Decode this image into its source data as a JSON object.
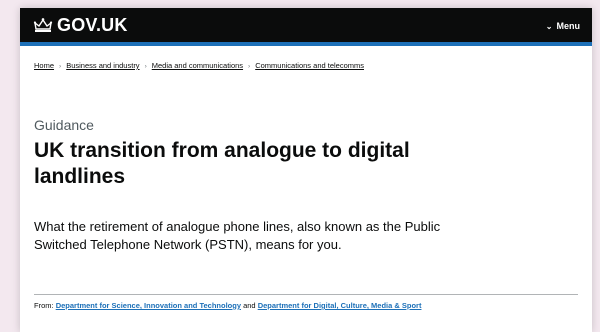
{
  "header": {
    "logo_text": "GOV.UK",
    "menu_label": "Menu",
    "brand_color": "#0b0c0c",
    "accent_color": "#1d70b8"
  },
  "breadcrumb": [
    "Home",
    "Business and industry",
    "Media and communications",
    "Communications and telecomms"
  ],
  "main": {
    "caption": "Guidance",
    "title": "UK transition from analogue to digital landlines",
    "lede": "What the retirement of analogue phone lines, also known as the Public Switched Telephone Network (PSTN), means for you."
  },
  "metadata": {
    "from_label": "From:",
    "org_1": "Department for Science, Innovation and Technology",
    "and_label": "and",
    "org_2": "Department for Digital, Culture, Media & Sport"
  }
}
